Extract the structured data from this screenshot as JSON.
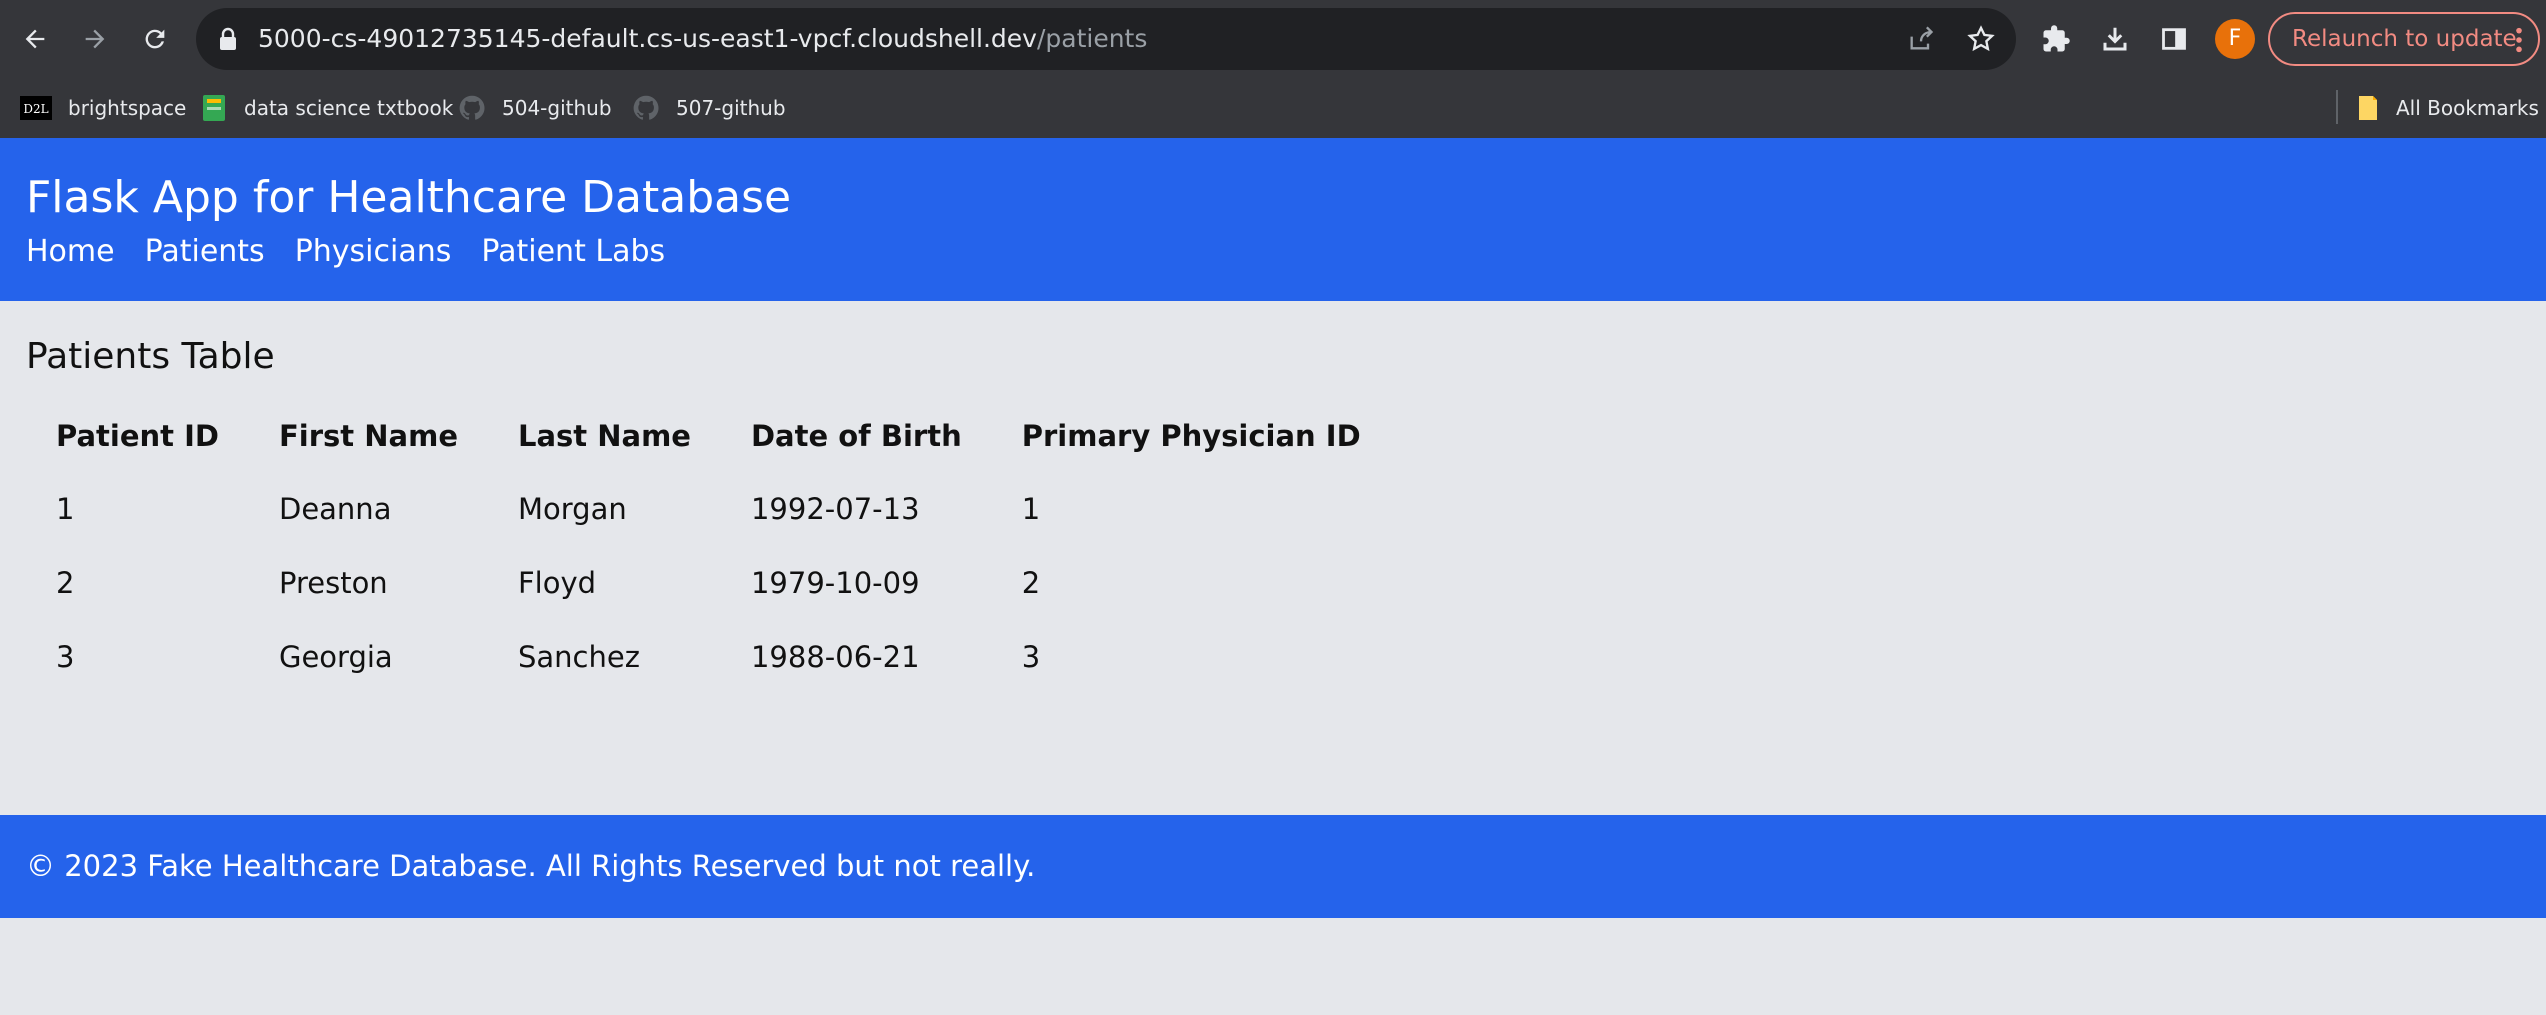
{
  "browser": {
    "url_host": "5000-cs-49012735145-default.cs-us-east1-vpcf.cloudshell.dev",
    "url_path": "/patients",
    "avatar_letter": "F",
    "relaunch_label": "Relaunch to update",
    "bookmarks": [
      {
        "label": "brightspace",
        "icon": "d2l-icon"
      },
      {
        "label": "data science txtbook",
        "icon": "book-icon"
      },
      {
        "label": "504-github",
        "icon": "github-icon"
      },
      {
        "label": "507-github",
        "icon": "github-icon"
      }
    ],
    "all_bookmarks_label": "All Bookmarks"
  },
  "header": {
    "title": "Flask App for Healthcare Database",
    "nav": [
      "Home",
      "Patients",
      "Physicians",
      "Patient Labs"
    ]
  },
  "main": {
    "section_title": "Patients Table",
    "columns": [
      "Patient ID",
      "First Name",
      "Last Name",
      "Date of Birth",
      "Primary Physician ID"
    ],
    "rows": [
      [
        "1",
        "Deanna",
        "Morgan",
        "1992-07-13",
        "1"
      ],
      [
        "2",
        "Preston",
        "Floyd",
        "1979-10-09",
        "2"
      ],
      [
        "3",
        "Georgia",
        "Sanchez",
        "1988-06-21",
        "3"
      ]
    ]
  },
  "footer": {
    "text": "© 2023 Fake Healthcare Database. All Rights Reserved but not really."
  },
  "colors": {
    "accent": "#2563eb",
    "page_bg": "#e5e7eb",
    "chrome_bg": "#35363a"
  }
}
